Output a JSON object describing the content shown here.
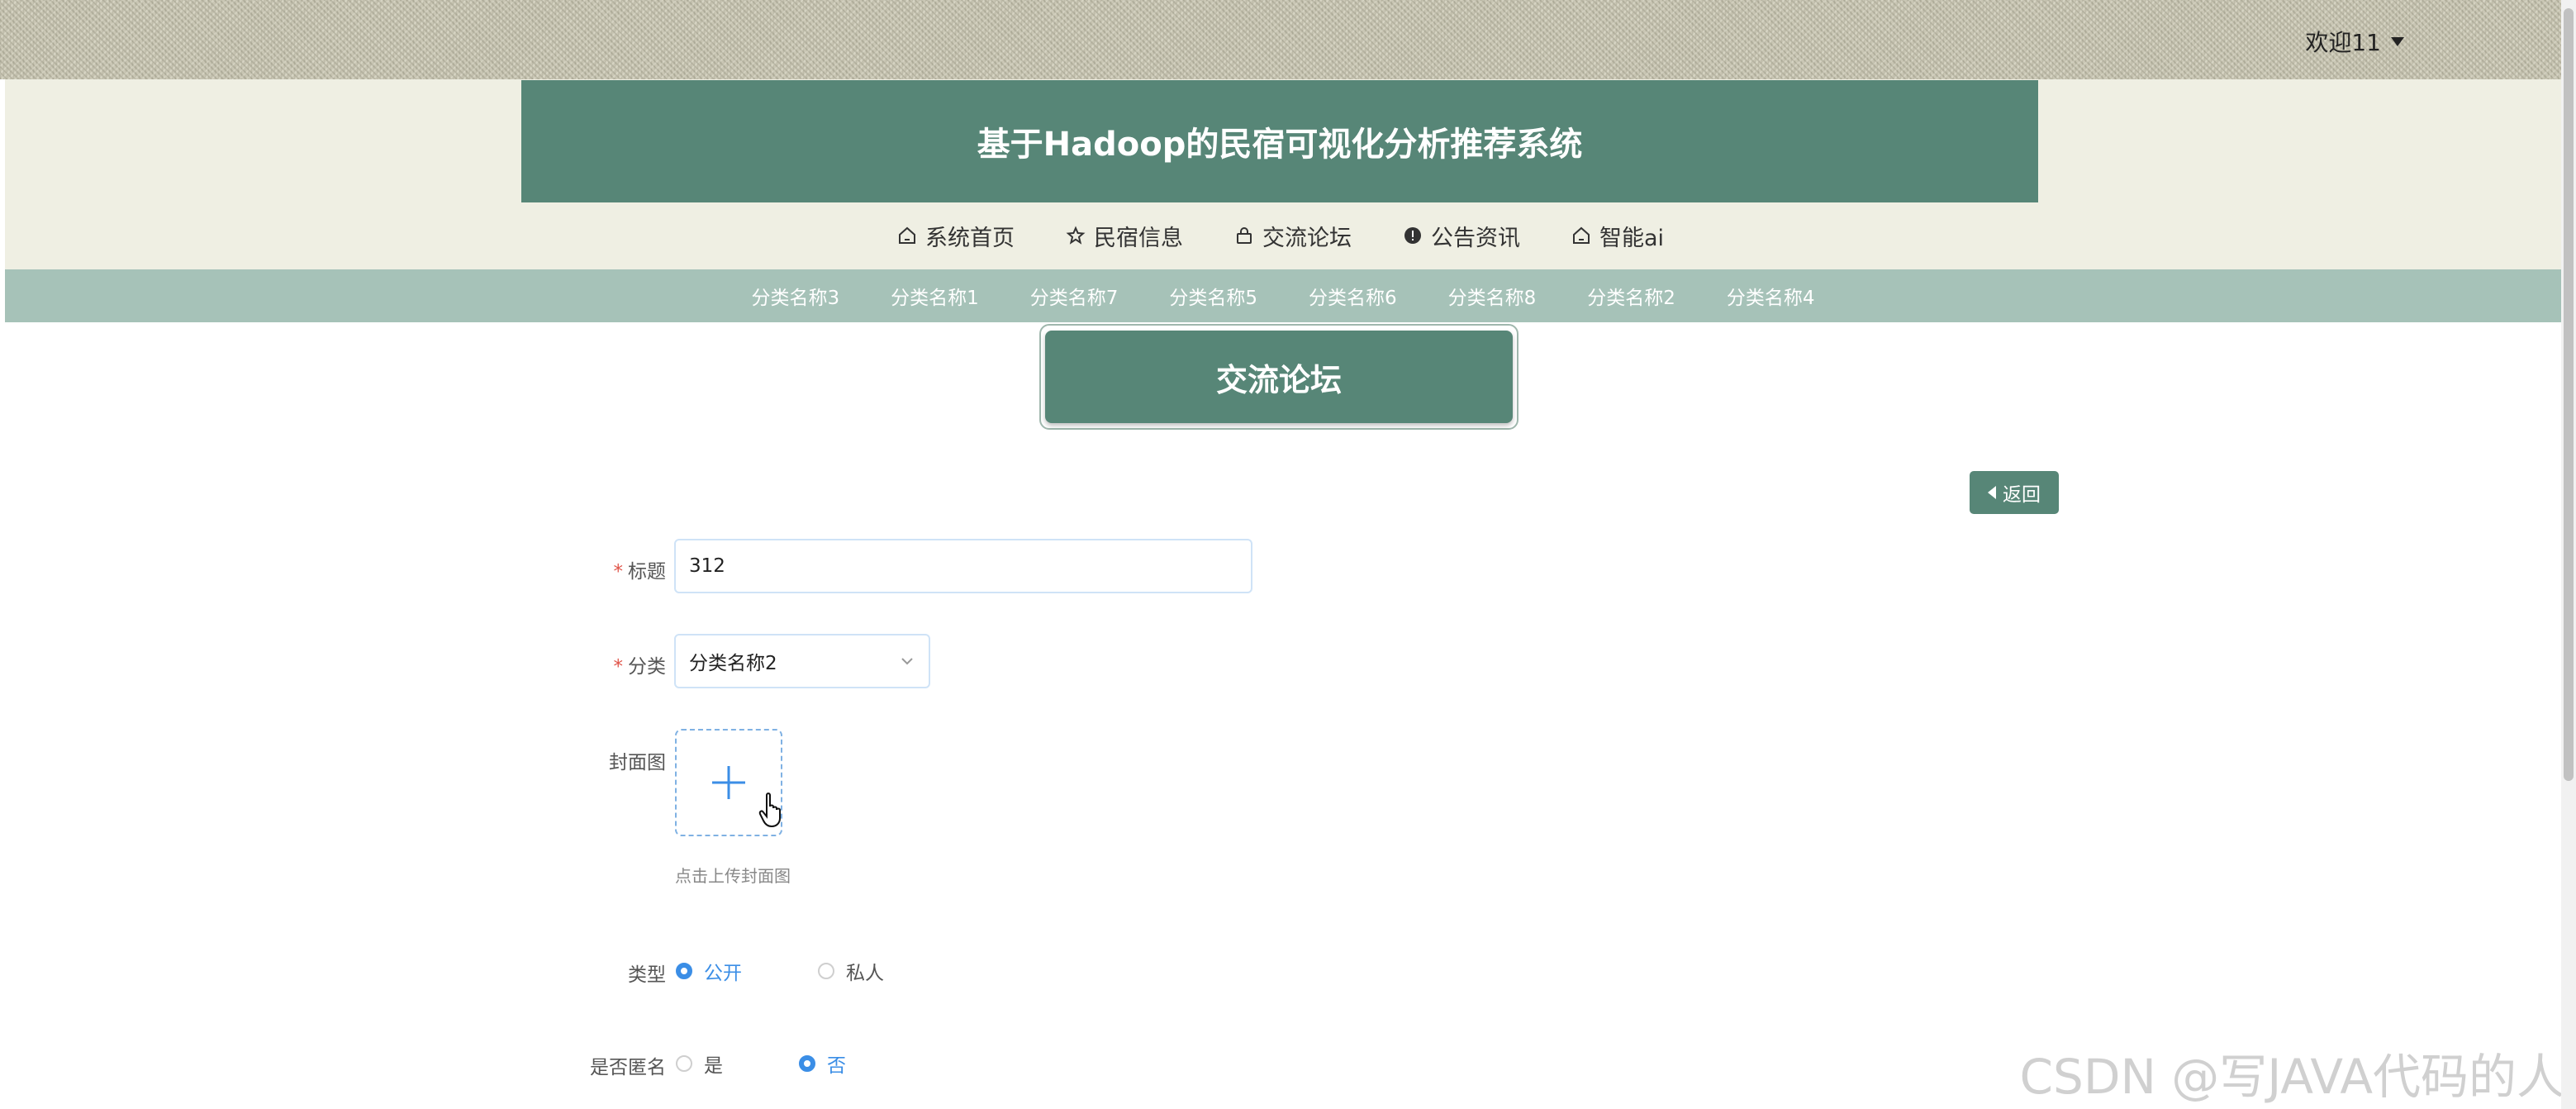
{
  "header": {
    "welcome_text": "欢迎11",
    "system_title": "基于Hadoop的民宿可视化分析推荐系统"
  },
  "main_nav": [
    {
      "label": "系统首页",
      "icon": "home-icon"
    },
    {
      "label": "民宿信息",
      "icon": "star-icon"
    },
    {
      "label": "交流论坛",
      "icon": "lock-icon"
    },
    {
      "label": "公告资讯",
      "icon": "alert-icon"
    },
    {
      "label": "智能ai",
      "icon": "home-icon"
    }
  ],
  "categories": [
    "分类名称3",
    "分类名称1",
    "分类名称7",
    "分类名称5",
    "分类名称6",
    "分类名称8",
    "分类名称2",
    "分类名称4"
  ],
  "page_title": "交流论坛",
  "back_button": "返回",
  "form": {
    "title_label": "标题",
    "title_value": "312",
    "category_label": "分类",
    "category_value": "分类名称2",
    "cover_label": "封面图",
    "cover_hint": "点击上传封面图",
    "type_label": "类型",
    "type_options": [
      "公开",
      "私人"
    ],
    "type_selected": "公开",
    "anon_label": "是否匿名",
    "anon_options": [
      "是",
      "否"
    ],
    "anon_selected": "否"
  },
  "watermark": "CSDN @写JAVA代码的人",
  "colors": {
    "primary": "#578677",
    "category_bar": "#a6c2b8",
    "header_bg": "#efefe3",
    "radio_active": "#3b8ee6",
    "required": "#e0554a"
  }
}
